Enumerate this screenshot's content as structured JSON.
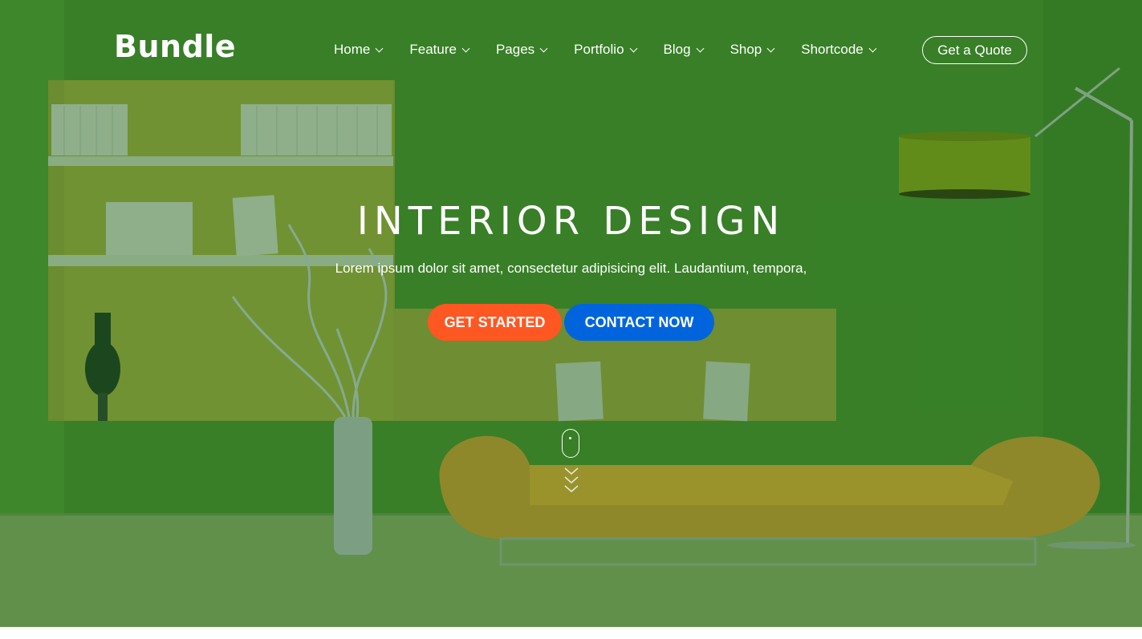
{
  "brand": {
    "logo_text": "Bundle"
  },
  "nav": {
    "items": [
      {
        "label": "Home"
      },
      {
        "label": "Feature"
      },
      {
        "label": "Pages"
      },
      {
        "label": "Portfolio"
      },
      {
        "label": "Blog"
      },
      {
        "label": "Shop"
      },
      {
        "label": "Shortcode"
      }
    ],
    "quote_button": "Get a Quote"
  },
  "hero": {
    "title": "INTERIOR DESIGN",
    "subtitle": "Lorem ipsum dolor sit amet, consectetur adipisicing elit. Laudantium, tempora,",
    "primary_button": "GET STARTED",
    "secondary_button": "CONTACT NOW",
    "scroll_icon": "mouse-scroll-icon"
  },
  "colors": {
    "primary_button": "#ff5722",
    "secondary_button": "#0065dd",
    "hero_tint": "#3f7d2b"
  }
}
